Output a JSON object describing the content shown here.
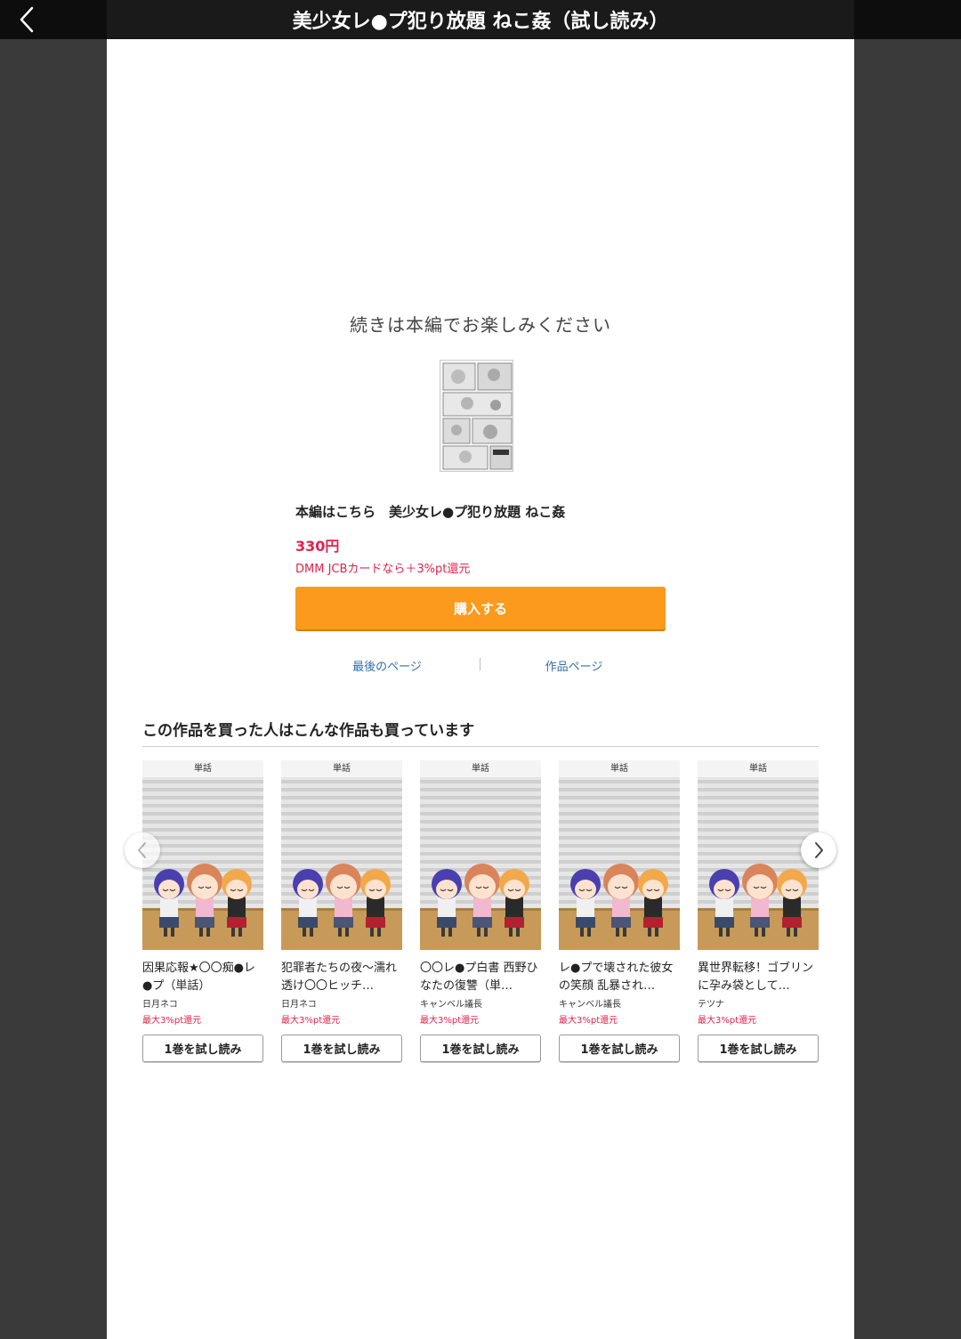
{
  "header": {
    "title": "美少女レ●プ犯り放題 ねこ姦（試し読み）"
  },
  "end_panel": {
    "continue_message": "続きは本編でお楽しみください",
    "book_title": "本編はこちら　美少女レ●プ犯り放題 ねこ姦",
    "price": "330円",
    "point_note": "DMM JCBカードなら＋3%pt還元",
    "buy_label": "購入する",
    "last_page_label": "最後のページ",
    "work_page_label": "作品ページ"
  },
  "recommendations": {
    "heading": "この作品を買った人はこんな作品も買っています",
    "trial_label": "1巻を試し読み",
    "items": [
      {
        "tag": "単話",
        "title": "因果応報★〇〇痴●レ●プ（単話）",
        "author": "日月ネコ",
        "point": "最大3%pt還元"
      },
      {
        "tag": "単話",
        "title": "犯罪者たちの夜〜濡れ透け〇〇ヒッチ…",
        "author": "日月ネコ",
        "point": "最大3%pt還元"
      },
      {
        "tag": "単話",
        "title": "〇〇レ●プ白書 西野ひなたの復讐（単…",
        "author": "キャンベル議長",
        "point": "最大3%pt還元"
      },
      {
        "tag": "単話",
        "title": "レ●プで壊された彼女の笑顔 乱暴され…",
        "author": "キャンベル議長",
        "point": "最大3%pt還元"
      },
      {
        "tag": "単話",
        "title": "異世界転移！ゴブリンに孕み袋として…",
        "author": "テツナ",
        "point": "最大3%pt還元"
      }
    ]
  },
  "icons": {
    "back": "chevron-left-icon",
    "prev": "chevron-left-icon",
    "next": "chevron-right-icon"
  },
  "colors": {
    "accent_orange": "#fb9a1c",
    "price_red": "#e0234e",
    "link_blue": "#2f6fa7"
  }
}
